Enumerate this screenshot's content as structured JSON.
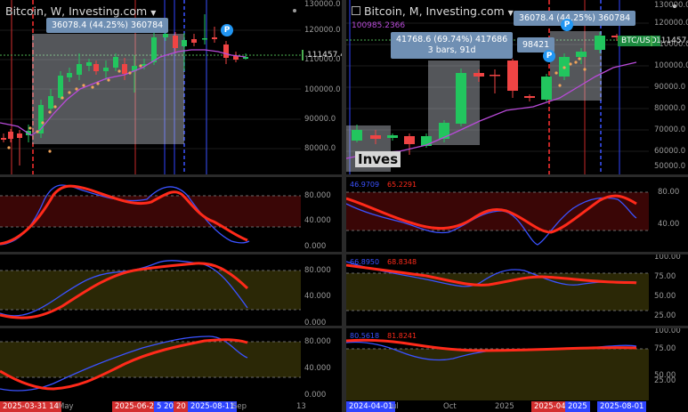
{
  "left": {
    "title": "Bitcoin, W, Investing.com",
    "measure": "36078.4 (44.25%) 360784",
    "price_tag": "111457.4",
    "price_axis": [
      "130000.0",
      "120000.0",
      "110000.0",
      "100000.0",
      "90000.0",
      "80000.0"
    ],
    "ind_axis": [
      "80.000",
      "40.000",
      "0.000"
    ],
    "dates": [
      {
        "text": "2025-03-31 14",
        "style": "red"
      },
      {
        "text": "May",
        "style": "plain"
      },
      {
        "text": "2025-06-23",
        "style": "red"
      },
      {
        "text": "5 20",
        "style": "blue"
      },
      {
        "text": "20",
        "style": "red"
      },
      {
        "text": "2025-08-11",
        "style": "blue"
      },
      {
        "text": "Sep",
        "style": "plain"
      },
      {
        "text": "13",
        "style": "plain"
      }
    ]
  },
  "right": {
    "title": "Bitcoin, M, Investing.com",
    "low_label": "100985.2366",
    "measure_top": "36078.4 (44.25%) 360784",
    "measure_mid_line1": "41768.6 (69.74%) 417686",
    "measure_mid_line2": "3 bars, 91d",
    "measure_side": "98421",
    "symbol_tag": "BTC/USD",
    "price_tag": "111457.4",
    "watermark": "Inves",
    "price_axis": [
      "130000.0",
      "120000.0",
      "110000.0",
      "100000.0",
      "90000.0",
      "80000.0",
      "70000.0",
      "60000.0",
      "50000.0"
    ],
    "ind1_axis": [
      "80.00",
      "40.00"
    ],
    "ind1_label_blue": "46.9709",
    "ind1_label_red": "65.2291",
    "ind2_axis": [
      "100.00",
      "75.00",
      "50.00",
      "25.00"
    ],
    "ind2_label_blue": "66.8950",
    "ind2_label_red": "68.8348",
    "ind3_axis": [
      "100.00",
      "75.00",
      "50.00",
      "25.00"
    ],
    "ind3_label_blue": "80.5618",
    "ind3_label_red": "81.8241",
    "dates": [
      {
        "text": "2024-04-01",
        "style": "blue"
      },
      {
        "text": "ul",
        "style": "plain"
      },
      {
        "text": "Oct",
        "style": "plain"
      },
      {
        "text": "2025",
        "style": "plain"
      },
      {
        "text": "2025-04-",
        "style": "red"
      },
      {
        "text": "2025",
        "style": "blue"
      },
      {
        "text": "2025-08-01",
        "style": "blue"
      }
    ]
  },
  "badge_letter": "P",
  "colors": {
    "up": "#22c55e",
    "down": "#ef4444",
    "ma": "#b84ad8",
    "red_line": "#ff2a1a",
    "blue_line": "#3a52ff",
    "zone_red": "#3a0606",
    "zone_olive": "#2b2806"
  }
}
